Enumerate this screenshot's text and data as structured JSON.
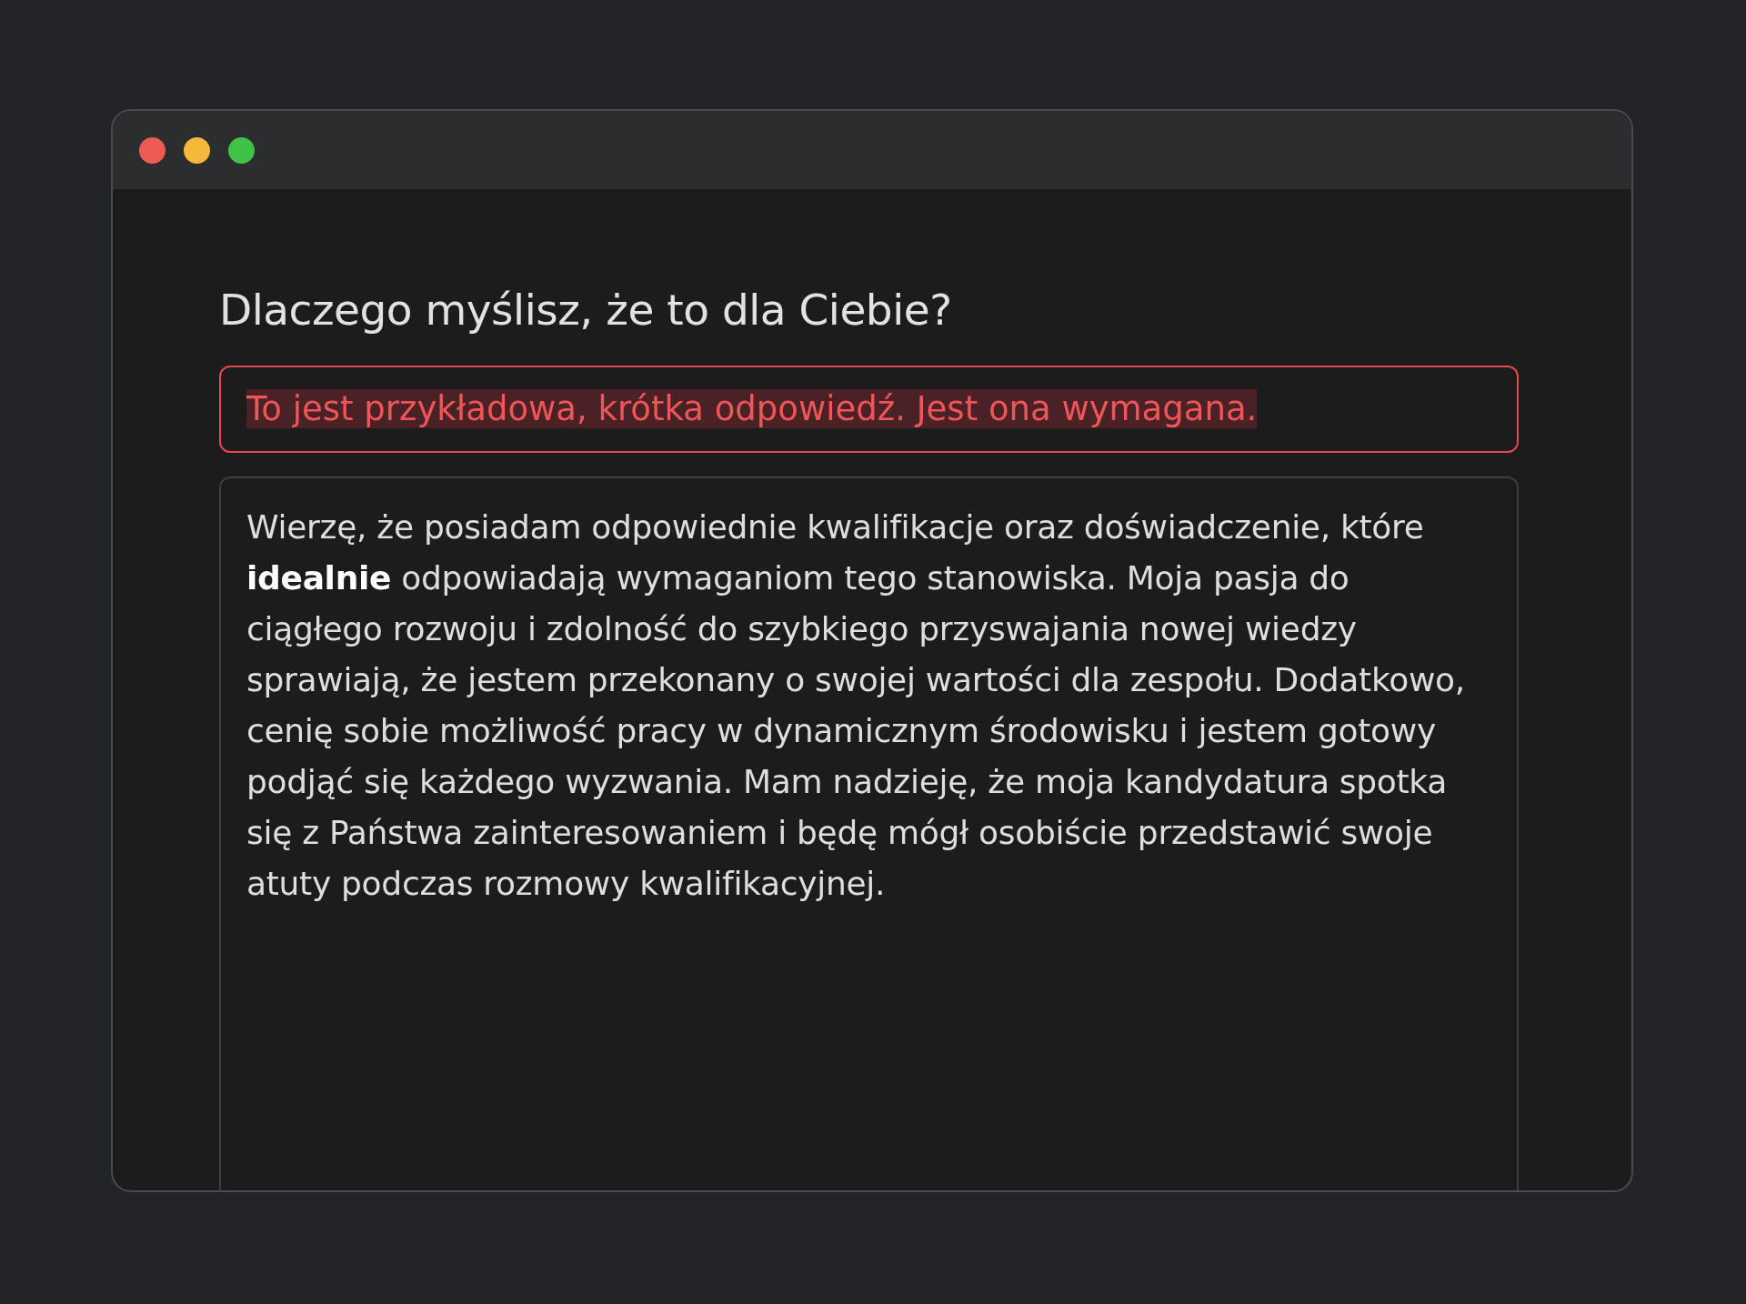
{
  "question": {
    "title": "Dlaczego myślisz, że to dla Ciebie?"
  },
  "short_answer": {
    "value": "To jest przykładowa, krótka odpowiedź. Jest ona wymagana.",
    "invalid": true
  },
  "long_answer": {
    "value": "Wierzę, że posiadam odpowiednie kwalifikacje oraz doświadczenie, które **idealnie** odpowiadają wymaganiom tego stanowiska. Moja pasja do ciągłego rozwoju i zdolność do szybkiego przyswajania nowej wiedzy sprawiają, że jestem przekonany o swojej wartości dla zespołu. Dodatkowo, cenię sobie możliwość pracy w dynamicznym środowisku i jestem gotowy podjąć się każdego wyzwania. Mam nadzieję, że moja kandydatura spotka się z Państwa zainteresowaniem i będę mógł osobiście przedstawić swoje atuty podczas rozmowy kwalifikacyjnej."
  }
}
